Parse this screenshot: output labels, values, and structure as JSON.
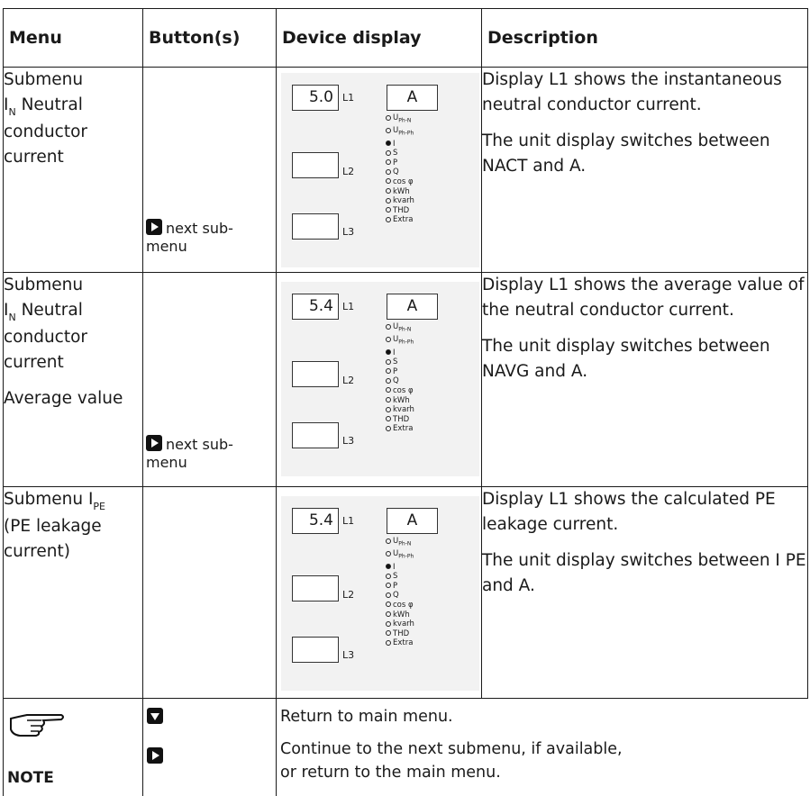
{
  "headers": {
    "menu": "Menu",
    "buttons": "Button(s)",
    "display": "Device display",
    "description": "Description"
  },
  "rows": [
    {
      "menu": {
        "line1": "Submenu",
        "sym": "I",
        "sub": "N",
        "line2": " Neutral",
        "line3": "conductor",
        "line4": "current",
        "extra": ""
      },
      "button": {
        "label": "next sub-",
        "label2": "menu"
      },
      "display": {
        "l1": "5.0",
        "unit": "A"
      },
      "description": [
        "Display L1 shows the instantaneous neutral conductor current.",
        "The unit display switches between NACT and A."
      ]
    },
    {
      "menu": {
        "line1": "Submenu",
        "sym": "I",
        "sub": "N",
        "line2": " Neutral",
        "line3": "conductor",
        "line4": "current",
        "extra": "Average value"
      },
      "button": {
        "label": "next sub-",
        "label2": "menu"
      },
      "display": {
        "l1": "5.4",
        "unit": "A"
      },
      "description": [
        "Display L1 shows the average value of the neutral conductor current.",
        "The unit display switches between NAVG and A."
      ]
    },
    {
      "menu": {
        "line1": "Submenu I",
        "sub": "PE",
        "line2": "(PE leakage",
        "line3": "current)"
      },
      "button": {
        "label": "",
        "label2": ""
      },
      "display": {
        "l1": "5.4",
        "unit": "A"
      },
      "description": [
        "Display L1 shows the calculated PE leakage current.",
        "The unit display switches between I PE and A."
      ]
    }
  ],
  "display_labels": {
    "l1": "L1",
    "l2": "L2",
    "l3": "L3"
  },
  "indicators": [
    "U",
    "U",
    "I",
    "S",
    "P",
    "Q",
    "cos φ",
    "kWh",
    "kvarh",
    "THD",
    "Extra"
  ],
  "indicator_subs": [
    "Ph-N",
    "Ph-Ph"
  ],
  "active_indicator": "I",
  "note": {
    "label": "NOTE",
    "down_text": "Return to main menu.",
    "right_text1": "Continue to the next submenu, if available,",
    "right_text2": "or return to the main menu."
  }
}
